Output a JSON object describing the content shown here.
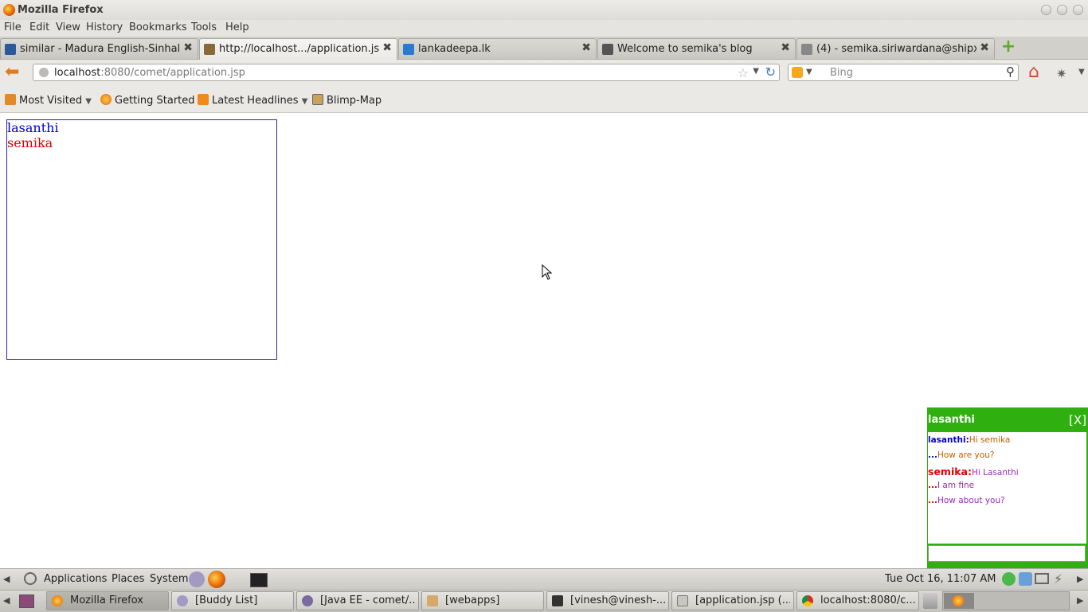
{
  "window": {
    "title": "Mozilla Firefox"
  },
  "menu": [
    "File",
    "Edit",
    "View",
    "History",
    "Bookmarks",
    "Tools",
    "Help"
  ],
  "tabs": [
    {
      "label": "similar - Madura English-Sinhal...",
      "icon": "madura-icon",
      "color": "#2a5a9a"
    },
    {
      "label": "http://localhost.../application.jsp",
      "icon": "page-icon",
      "color": "#8a6a3a"
    },
    {
      "label": "lankadeepa.lk",
      "icon": "lankadeepa-icon",
      "color": "#2a7ad0"
    },
    {
      "label": "Welcome to semika's blog",
      "icon": "blog-icon",
      "color": "#555555"
    },
    {
      "label": "(4) - semika.siriwardana@shipx...",
      "icon": "mail-icon",
      "color": "#888888"
    }
  ],
  "nav": {
    "url_host": "localhost",
    "url_rest": ":8080/comet/application.jsp",
    "search_placeholder": "Bing"
  },
  "bookmarks": [
    {
      "label": "Most Visited",
      "icon": "most-visited-icon",
      "has_dropdown": true
    },
    {
      "label": "Getting Started",
      "icon": "firefox-icon",
      "has_dropdown": false
    },
    {
      "label": "Latest Headlines",
      "icon": "rss-icon",
      "has_dropdown": true
    },
    {
      "label": "Blimp-Map",
      "icon": "blimp-map-icon",
      "has_dropdown": false
    }
  ],
  "users": [
    {
      "name": "lasanthi",
      "color": "#0000cc"
    },
    {
      "name": "semika",
      "color": "#dd0000"
    }
  ],
  "chat": {
    "title": "lasanthi",
    "close_label": "[X]",
    "messages": [
      {
        "who": "lasanthi:",
        "text": "Hi semika",
        "who_color": "#0000cc",
        "text_color": "#c06000"
      },
      {
        "who": "...",
        "text": "How are you?",
        "who_color": "#0000cc",
        "text_color": "#c06000"
      },
      {
        "who": "semika:",
        "text": "Hi Lasanthi",
        "who_color": "#dd0000",
        "text_color": "#9a2ac0"
      },
      {
        "who": "...",
        "text": "I am fine",
        "who_color": "#dd0000",
        "text_color": "#9a2ac0"
      },
      {
        "who": "...",
        "text": "How about you?",
        "who_color": "#dd0000",
        "text_color": "#9a2ac0"
      }
    ]
  },
  "panel_top": {
    "menus": [
      "Applications",
      "Places",
      "System"
    ],
    "clock": "Tue Oct 16, 11:07 AM"
  },
  "taskbar": [
    {
      "label": "Mozilla Firefox",
      "icon": "firefox-icon",
      "active": true
    },
    {
      "label": "[Buddy List]",
      "icon": "pidgin-icon",
      "active": false
    },
    {
      "label": "[Java EE - comet/...",
      "icon": "eclipse-icon",
      "active": false
    },
    {
      "label": "[webapps]",
      "icon": "folder-icon",
      "active": false
    },
    {
      "label": "[vinesh@vinesh-...",
      "icon": "terminal-icon",
      "active": false
    },
    {
      "label": "[application.jsp (...",
      "icon": "editor-icon",
      "active": false
    },
    {
      "label": "localhost:8080/c...",
      "icon": "chrome-icon",
      "active": false
    }
  ]
}
